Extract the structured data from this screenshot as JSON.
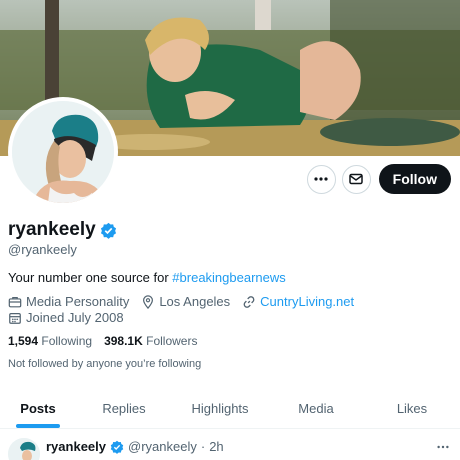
{
  "profile": {
    "display_name": "ryankeely",
    "handle": "@ryankeely",
    "bio_text": "Your number one source for ",
    "bio_hashtag": "#breakingbearnews",
    "category": "Media Personality",
    "location": "Los Angeles",
    "website": "CuntryLiving.net",
    "joined": "Joined July 2008",
    "following_count": "1,594",
    "following_label": "Following",
    "followers_count": "398.1K",
    "followers_label": "Followers",
    "not_followed_note": "Not followed by anyone you’re following"
  },
  "actions": {
    "more_icon": "more-icon",
    "message_icon": "mail-icon",
    "follow_label": "Follow"
  },
  "tabs": [
    {
      "label": "Posts"
    },
    {
      "label": "Replies"
    },
    {
      "label": "Highlights"
    },
    {
      "label": "Media"
    },
    {
      "label": "Likes"
    }
  ],
  "tweet": {
    "name": "ryankeely",
    "handle": "@ryankeely",
    "separator": "·",
    "time": "2h"
  },
  "colors": {
    "accent": "#1d9bf0",
    "text": "#0f1419",
    "muted": "#536471",
    "follow_bg": "#0f1419"
  }
}
